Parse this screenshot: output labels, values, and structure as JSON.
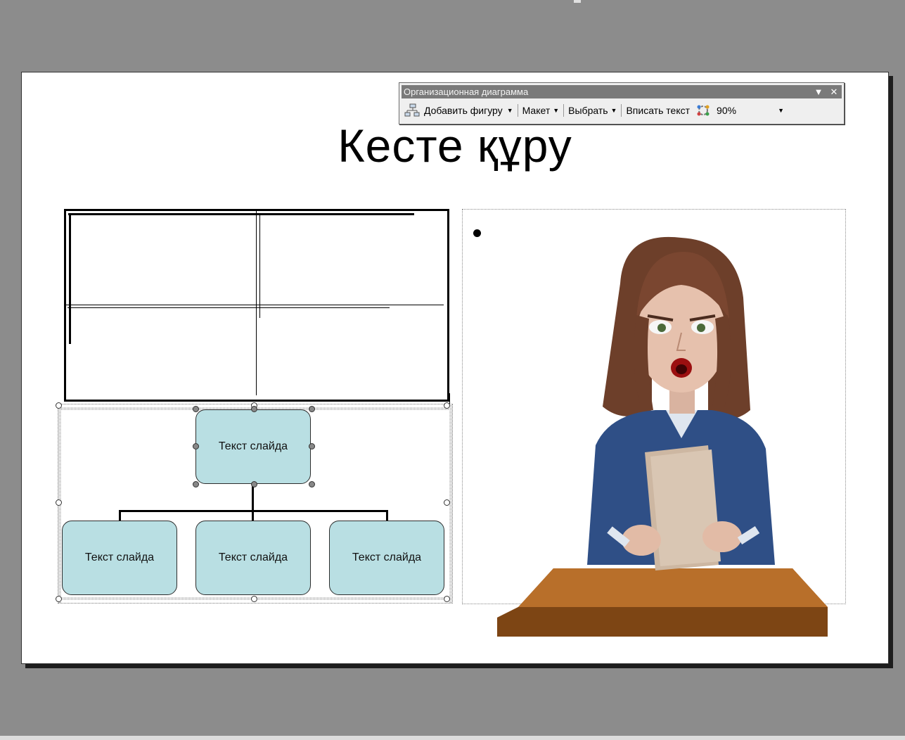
{
  "slide": {
    "title": "Кесте құру"
  },
  "org_chart": {
    "top_box": "Текст слайда",
    "bottom_boxes": [
      "Текст слайда",
      "Текст слайда",
      "Текст слайда"
    ],
    "box_color": "#b9dfe3"
  },
  "toolbar": {
    "title": "Организационная диаграмма",
    "menu_icon": "chevron-down-icon",
    "close_icon": "close-icon",
    "menu_glyph": "▼",
    "close_glyph": "✕",
    "add_shape_label": "Добавить фигуру",
    "layout_label": "Макет",
    "select_label": "Выбрать",
    "fit_text_label": "Вписать текст",
    "zoom_value": "90%"
  },
  "colors": {
    "background": "#8c8c8c",
    "slide": "#ffffff",
    "toolbar_title_bar": "#7a7a7a"
  }
}
